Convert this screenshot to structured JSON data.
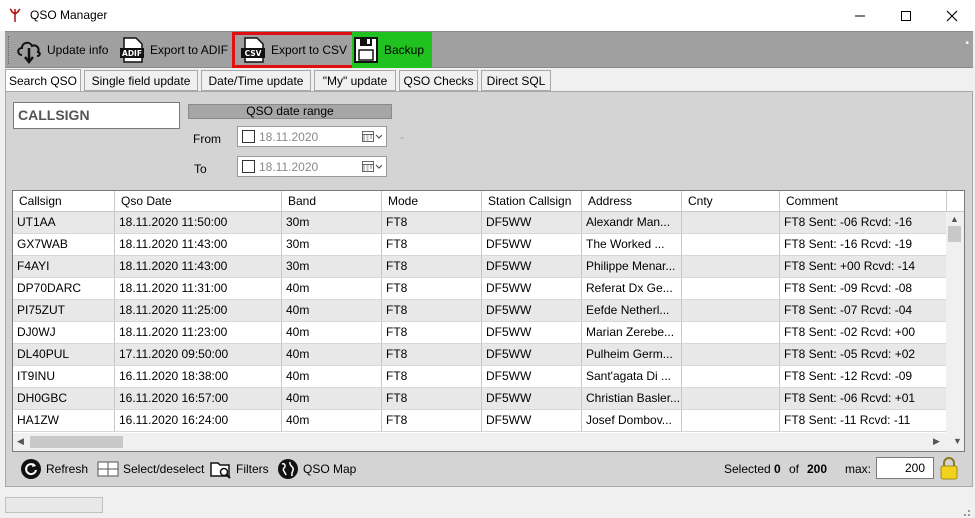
{
  "window": {
    "title": "QSO Manager"
  },
  "toolbar": {
    "update_info": "Update info",
    "export_adif": "Export to ADIF",
    "adif_icon_text": "ADIF",
    "export_csv": "Export to CSV",
    "csv_icon_text": "CSV",
    "backup": "Backup",
    "more": "•"
  },
  "tabs": [
    {
      "label": "Search QSO"
    },
    {
      "label": "Single field update"
    },
    {
      "label": "Date/Time update"
    },
    {
      "label": "\"My\" update"
    },
    {
      "label": "QSO Checks"
    },
    {
      "label": "Direct SQL"
    }
  ],
  "search": {
    "callsign_value": "CALLSIGN",
    "range_header": "QSO date range",
    "from_label": "From",
    "to_label": "To",
    "from_date": "18.11.2020",
    "to_date": "18.11.2020",
    "dash": "-"
  },
  "grid": {
    "columns": [
      "Callsign",
      "Qso Date",
      "Band",
      "Mode",
      "Station Callsign",
      "Address",
      "Cnty",
      "Comment"
    ],
    "rows": [
      [
        "UT1AA",
        "18.11.2020 11:50:00",
        "30m",
        "FT8",
        "DF5WW",
        "Alexandr  Man...",
        "",
        "FT8  Sent: -06  Rcvd: -16"
      ],
      [
        "GX7WAB",
        "18.11.2020 11:43:00",
        "30m",
        "FT8",
        "DF5WW",
        "The Worked ...",
        "",
        "FT8  Sent: -16  Rcvd: -19"
      ],
      [
        "F4AYI",
        "18.11.2020 11:43:00",
        "30m",
        "FT8",
        "DF5WW",
        "Philippe Menar...",
        "",
        "FT8  Sent: +00  Rcvd: -14"
      ],
      [
        "DP70DARC",
        "18.11.2020 11:31:00",
        "40m",
        "FT8",
        "DF5WW",
        "Referat Dx Ge...",
        "",
        "FT8  Sent: -09  Rcvd: -08"
      ],
      [
        "PI75ZUT",
        "18.11.2020 11:25:00",
        "40m",
        "FT8",
        "DF5WW",
        "Eefde Netherl...",
        "",
        "FT8  Sent: -07  Rcvd: -04"
      ],
      [
        "DJ0WJ",
        "18.11.2020 11:23:00",
        "40m",
        "FT8",
        "DF5WW",
        "Marian Zerebe...",
        "",
        "FT8  Sent: -02  Rcvd: +00"
      ],
      [
        "DL40PUL",
        "17.11.2020 09:50:00",
        "40m",
        "FT8",
        "DF5WW",
        "Pulheim Germ...",
        "",
        "FT8  Sent: -05  Rcvd: +02"
      ],
      [
        "IT9INU",
        "16.11.2020 18:38:00",
        "40m",
        "FT8",
        "DF5WW",
        "Sant'agata Di ...",
        "",
        "FT8  Sent: -12  Rcvd: -09"
      ],
      [
        "DH0GBC",
        "16.11.2020 16:57:00",
        "40m",
        "FT8",
        "DF5WW",
        "Christian Basler...",
        "",
        "FT8  Sent: -06  Rcvd: +01"
      ],
      [
        "HA1ZW",
        "16.11.2020 16:24:00",
        "40m",
        "FT8",
        "DF5WW",
        "Josef Dombov...",
        "",
        "FT8  Sent: -11  Rcvd: -11"
      ]
    ]
  },
  "bottom": {
    "refresh": "Refresh",
    "select_deselect": "Select/deselect",
    "filters": "Filters",
    "qso_map": "QSO Map",
    "selected_label": "Selected",
    "selected_count": "0",
    "of_label": "of",
    "total_count": "200",
    "max_label": "max:",
    "max_value": "200"
  },
  "colors": {
    "highlight_border": "#e01010",
    "backup_bg": "#1fc21f"
  }
}
